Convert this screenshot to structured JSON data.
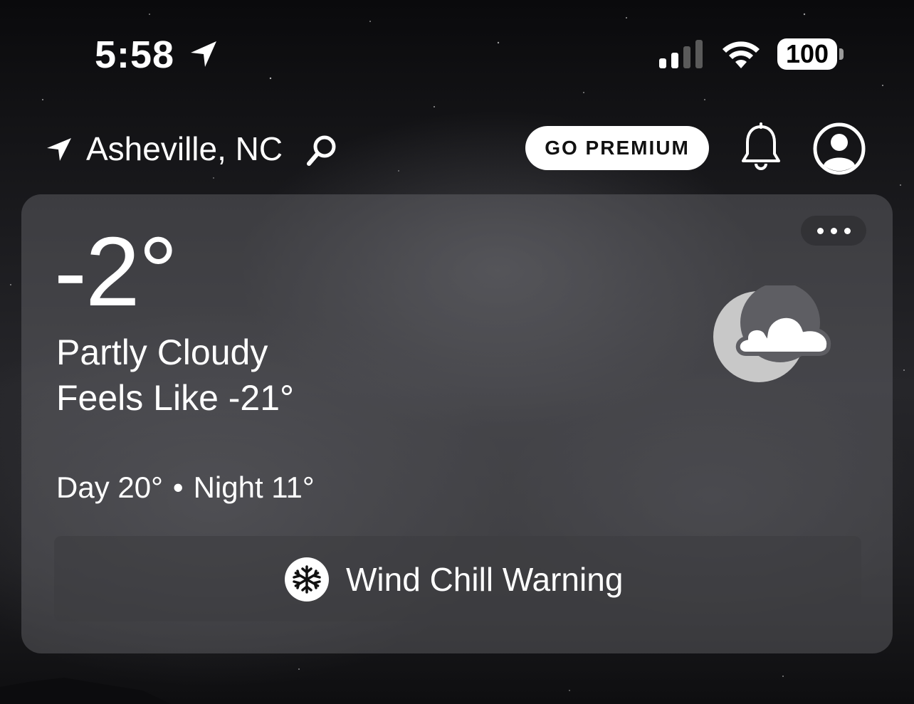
{
  "status_bar": {
    "time": "5:58",
    "battery": "100",
    "icons": [
      "location-arrow-icon",
      "signal-icon",
      "wifi-icon",
      "battery-icon"
    ]
  },
  "header": {
    "location": "Asheville, NC",
    "premium_label": "GO PREMIUM",
    "icons": [
      "navigation-arrow-icon",
      "search-icon",
      "bell-icon",
      "account-icon"
    ]
  },
  "current": {
    "temperature": "-2°",
    "condition": "Partly Cloudy",
    "feels_like": "Feels Like -21°",
    "day": "Day 20°",
    "separator": "•",
    "night": "Night 11°",
    "icon": "partly-cloudy-night-icon"
  },
  "alert": {
    "label": "Wind Chill Warning",
    "icon": "snowflake-icon"
  },
  "colors": {
    "text": "#ffffff",
    "card": "#5e5e63",
    "premium_bg": "#ffffff"
  }
}
